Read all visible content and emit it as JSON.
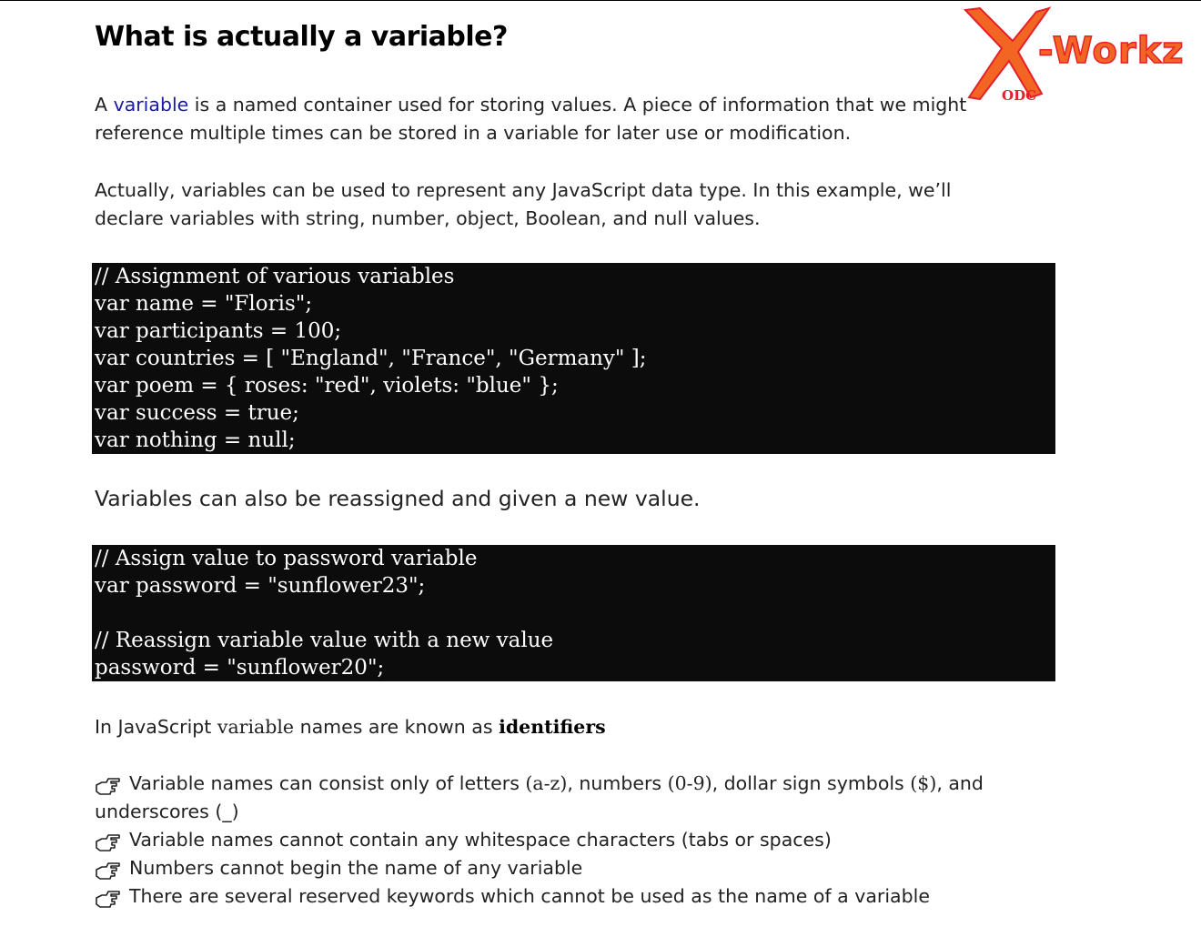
{
  "title": "What is actually a variable?",
  "logo": {
    "wordmark": "-Workz",
    "badge": "ODC",
    "colors": {
      "primary": "#f26522",
      "accent": "#e5202a"
    }
  },
  "intro": {
    "prefix": "A",
    "link_text": "variable",
    "rest": "is a named container used for storing values. A piece of information that we might reference multiple times can be stored in a variable for later use or modification."
  },
  "types_paragraph": "Actually, variables can be used to represent any JavaScript data type. In this example, we’ll declare variables with string, number, object, Boolean, and null values.",
  "code_block_1": [
    "// Assignment of various variables",
    "var name = \"Floris\";",
    "var participants = 100;",
    "var countries = [ \"England\", \"France\", \"Germany\" ];",
    "var poem = { roses: \"red\", violets: \"blue\" };",
    "var success = true;",
    "var nothing = null;"
  ],
  "reassign_text": "Variables can also be reassigned and given a new value.",
  "code_block_2": [
    "// Assign value to password variable",
    "var password = \"sunflower23\";",
    "",
    "// Reassign variable value with a new value",
    "password = \"sunflower20\";"
  ],
  "identifiers": {
    "prefix": "In JavaScript",
    "code_word": "variable",
    "middle": "names are known as",
    "keyword": "identifiers"
  },
  "rules": {
    "icon": "pointing-hand-icon",
    "rule1_a": "Variable names can consist only of letters",
    "rule1_b": "(a-z)",
    "rule1_c": ", numbers",
    "rule1_d": "(0-9)",
    "rule1_e": ", dollar sign symbols",
    "rule1_f": "($)",
    "rule1_g": ", and underscores",
    "rule1_h": "(_)",
    "rule2": "Variable names cannot contain any whitespace characters (tabs or spaces)",
    "rule3": "Numbers cannot begin the name of any variable",
    "rule4": "There are several reserved keywords which cannot be used as the name of a variable"
  },
  "colors": {
    "code_background": "#0c0c0d",
    "code_text": "#ffffff",
    "link": "#1a1aa6"
  }
}
